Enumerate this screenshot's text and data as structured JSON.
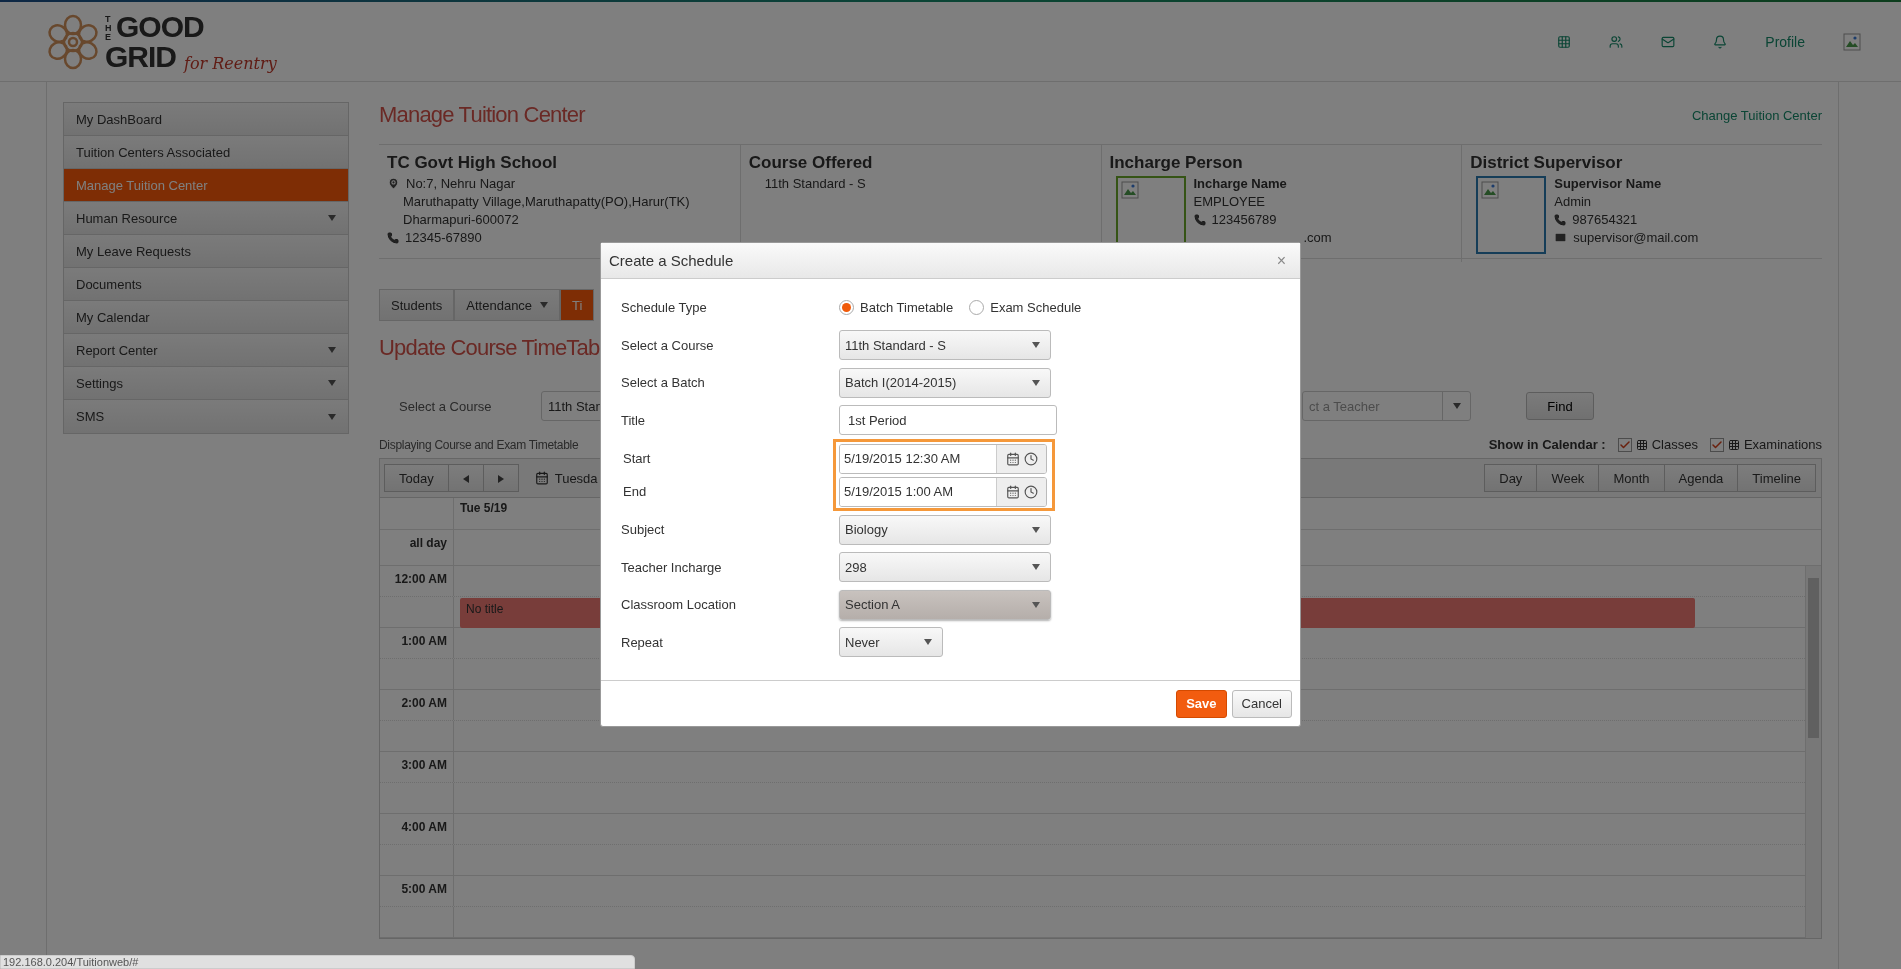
{
  "header": {
    "logo": {
      "small": "THE",
      "line1": "GOOD",
      "line2": "GRID",
      "tagline": "for Reentry"
    },
    "profile_link": "Profile"
  },
  "sidebar": {
    "items": [
      {
        "label": "My DashBoard",
        "selected": false,
        "expandable": false
      },
      {
        "label": "Tuition Centers Associated",
        "selected": false,
        "expandable": false
      },
      {
        "label": "Manage Tuition Center",
        "selected": true,
        "expandable": false
      },
      {
        "label": "Human Resource",
        "selected": false,
        "expandable": true
      },
      {
        "label": "My Leave Requests",
        "selected": false,
        "expandable": false
      },
      {
        "label": "Documents",
        "selected": false,
        "expandable": false
      },
      {
        "label": "My Calendar",
        "selected": false,
        "expandable": false
      },
      {
        "label": "Report Center",
        "selected": false,
        "expandable": true
      },
      {
        "label": "Settings",
        "selected": false,
        "expandable": true
      },
      {
        "label": "SMS",
        "selected": false,
        "expandable": true
      }
    ]
  },
  "page": {
    "title": "Manage Tuition Center",
    "action_link": "Change Tuition Center"
  },
  "info": {
    "center": {
      "name": "TC Govt High School",
      "address": [
        "No:7, Nehru Nagar",
        "Maruthapatty Village,Maruthapatty(PO),Harur(TK)",
        "Dharmapuri-600072"
      ],
      "phone": "12345-67890"
    },
    "course": {
      "heading": "Course Offered",
      "value": "11th Standard - S"
    },
    "incharge": {
      "heading": "Incharge Person",
      "name": "Incharge Name",
      "role": "EMPLOYEE",
      "phone": "123456789",
      "email": ".com"
    },
    "supervisor": {
      "heading": "District Supervisor",
      "name": "Supervisor Name",
      "role": "Admin",
      "phone": "987654321",
      "email": "supervisor@mail.com"
    }
  },
  "tabs": [
    {
      "label": "Students",
      "selected": false,
      "has_menu": false
    },
    {
      "label": "Attendance",
      "selected": false,
      "has_menu": true
    },
    {
      "label": "Ti",
      "selected": true,
      "has_menu": false
    }
  ],
  "section_title": "Update Course TimeTab",
  "filters": {
    "course_label": "Select a Course",
    "course_value": "11th Stan",
    "teacher_placeholder": "ct a Teacher",
    "find_button": "Find"
  },
  "display_note": "Displaying Course and Exam Timetable",
  "show_in_calendar": {
    "label": "Show in Calendar :",
    "options": [
      {
        "label": "Classes",
        "checked": true
      },
      {
        "label": "Examinations",
        "checked": true
      }
    ]
  },
  "calendar": {
    "today_button": "Today",
    "date_label": "Tuesda",
    "views": [
      {
        "label": "Day",
        "selected": false
      },
      {
        "label": "Week",
        "selected": false
      },
      {
        "label": "Month",
        "selected": false
      },
      {
        "label": "Agenda",
        "selected": false
      },
      {
        "label": "Timeline",
        "selected": false
      }
    ],
    "day_header": "Tue 5/19",
    "all_day_label": "all day",
    "hours": [
      "12:00 AM",
      "1:00 AM",
      "2:00 AM",
      "3:00 AM",
      "4:00 AM",
      "5:00 AM"
    ],
    "events": [
      {
        "title": "No title"
      }
    ]
  },
  "dialog": {
    "title": "Create a Schedule",
    "close": "×",
    "fields": [
      {
        "kind": "radio",
        "label": "Schedule Type",
        "options": [
          {
            "label": "Batch Timetable",
            "selected": true
          },
          {
            "label": "Exam Schedule",
            "selected": false
          }
        ]
      },
      {
        "kind": "select",
        "label": "Select a Course",
        "value": "11th Standard - S",
        "hovered": false
      },
      {
        "kind": "select",
        "label": "Select a Batch",
        "value": "Batch I(2014-2015)",
        "hovered": false
      },
      {
        "kind": "text",
        "label": "Title",
        "value": "1st Period"
      },
      {
        "kind": "datetime",
        "label": "Start",
        "value": "5/19/2015 12:30 AM",
        "highlighted": true
      },
      {
        "kind": "datetime",
        "label": "End",
        "value": "5/19/2015 1:00 AM",
        "highlighted": true
      },
      {
        "kind": "select",
        "label": "Subject",
        "value": "Biology",
        "hovered": false
      },
      {
        "kind": "select",
        "label": "Teacher Incharge",
        "value": "298",
        "hovered": false
      },
      {
        "kind": "select",
        "label": "Classroom Location",
        "value": "Section A",
        "hovered": true
      },
      {
        "kind": "short_select",
        "label": "Repeat",
        "value": "Never",
        "hovered": false
      }
    ],
    "buttons": [
      {
        "label": "Save",
        "primary": true
      },
      {
        "label": "Cancel",
        "primary": false
      }
    ]
  },
  "status_bar": "192.168.0.204/Tuitionweb/#"
}
